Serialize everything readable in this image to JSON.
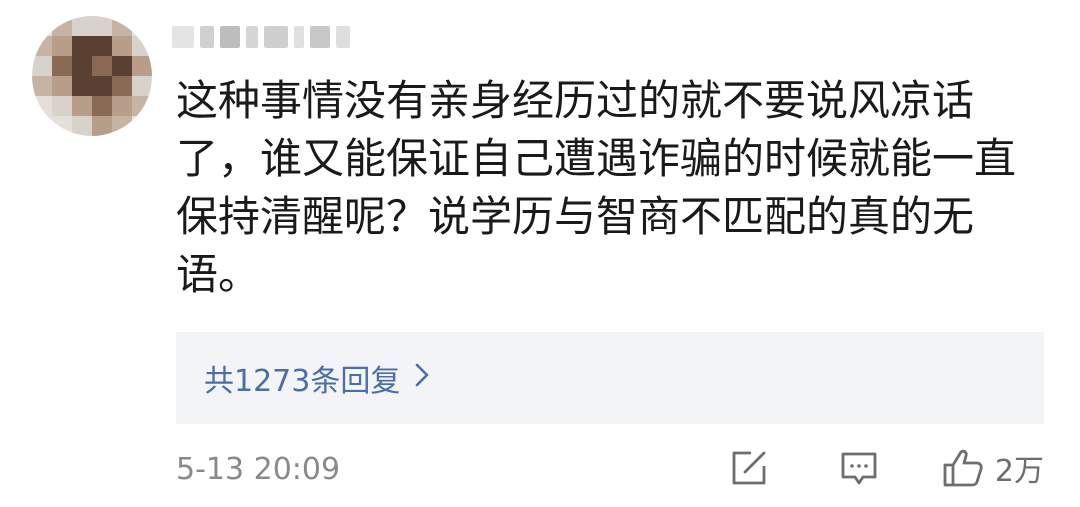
{
  "comment": {
    "author": {
      "avatar_palette": [
        "#d8d2cc",
        "#b89d8a",
        "#8a6a55",
        "#5a4033",
        "#c7b3a3",
        "#e6e0da"
      ]
    },
    "text": "这种事情没有亲身经历过的就不要说风凉话了，谁又能保证自己遭遇诈骗的时候就能一直保持清醒呢？说学历与智商不匹配的真的无语。",
    "replies_label": "共1273条回复",
    "timestamp": "5-13 20:09",
    "likes": "2万",
    "icons": {
      "share": "share-icon",
      "reply": "comment-icon",
      "like": "thumbs-up-icon"
    },
    "colors": {
      "link": "#4a6ea8",
      "muted": "#8a8a8a",
      "text": "#1a1a1a",
      "panel": "#f3f4f6"
    }
  }
}
